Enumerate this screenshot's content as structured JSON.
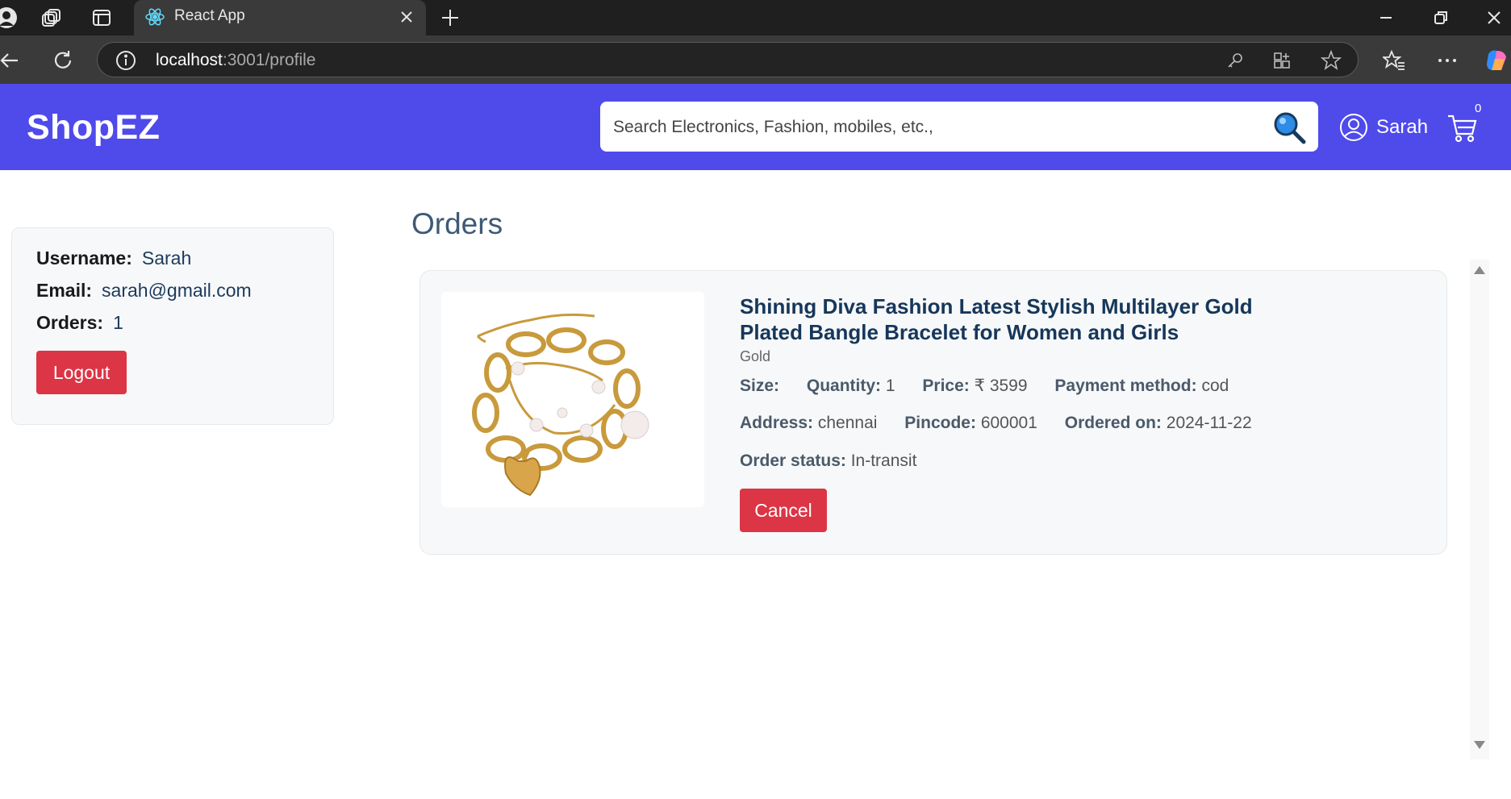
{
  "browser": {
    "tab_title": "React App",
    "url_host": "localhost",
    "url_rest": ":3001/profile"
  },
  "navbar": {
    "brand": "ShopEZ",
    "search_placeholder": "Search Electronics, Fashion, mobiles, etc.,",
    "user_name": "Sarah",
    "cart_count": "0",
    "bg_color": "#4f4aea"
  },
  "profile": {
    "username_label": "Username:",
    "username": "Sarah",
    "email_label": "Email:",
    "email": "sarah@gmail.com",
    "orders_label": "Orders:",
    "orders_count": "1",
    "logout_label": "Logout"
  },
  "orders": {
    "title": "Orders",
    "items": [
      {
        "title": "Shining Diva Fashion Latest Stylish Multilayer Gold Plated Bangle Bracelet for Women and Girls",
        "description": "Gold",
        "size_label": "Size:",
        "size": "",
        "quantity_label": "Quantity:",
        "quantity": "1",
        "price_label": "Price:",
        "price": "₹ 3599",
        "payment_label": "Payment method:",
        "payment": "cod",
        "address_label": "Address:",
        "address": "chennai",
        "pincode_label": "Pincode:",
        "pincode": "600001",
        "ordered_on_label": "Ordered on:",
        "ordered_on": "2024-11-22",
        "status_label": "Order status:",
        "status": "In-transit",
        "cancel_label": "Cancel"
      }
    ]
  },
  "colors": {
    "danger": "#dc3545",
    "title_blue": "#16375a",
    "heading": "#3d5a76"
  }
}
